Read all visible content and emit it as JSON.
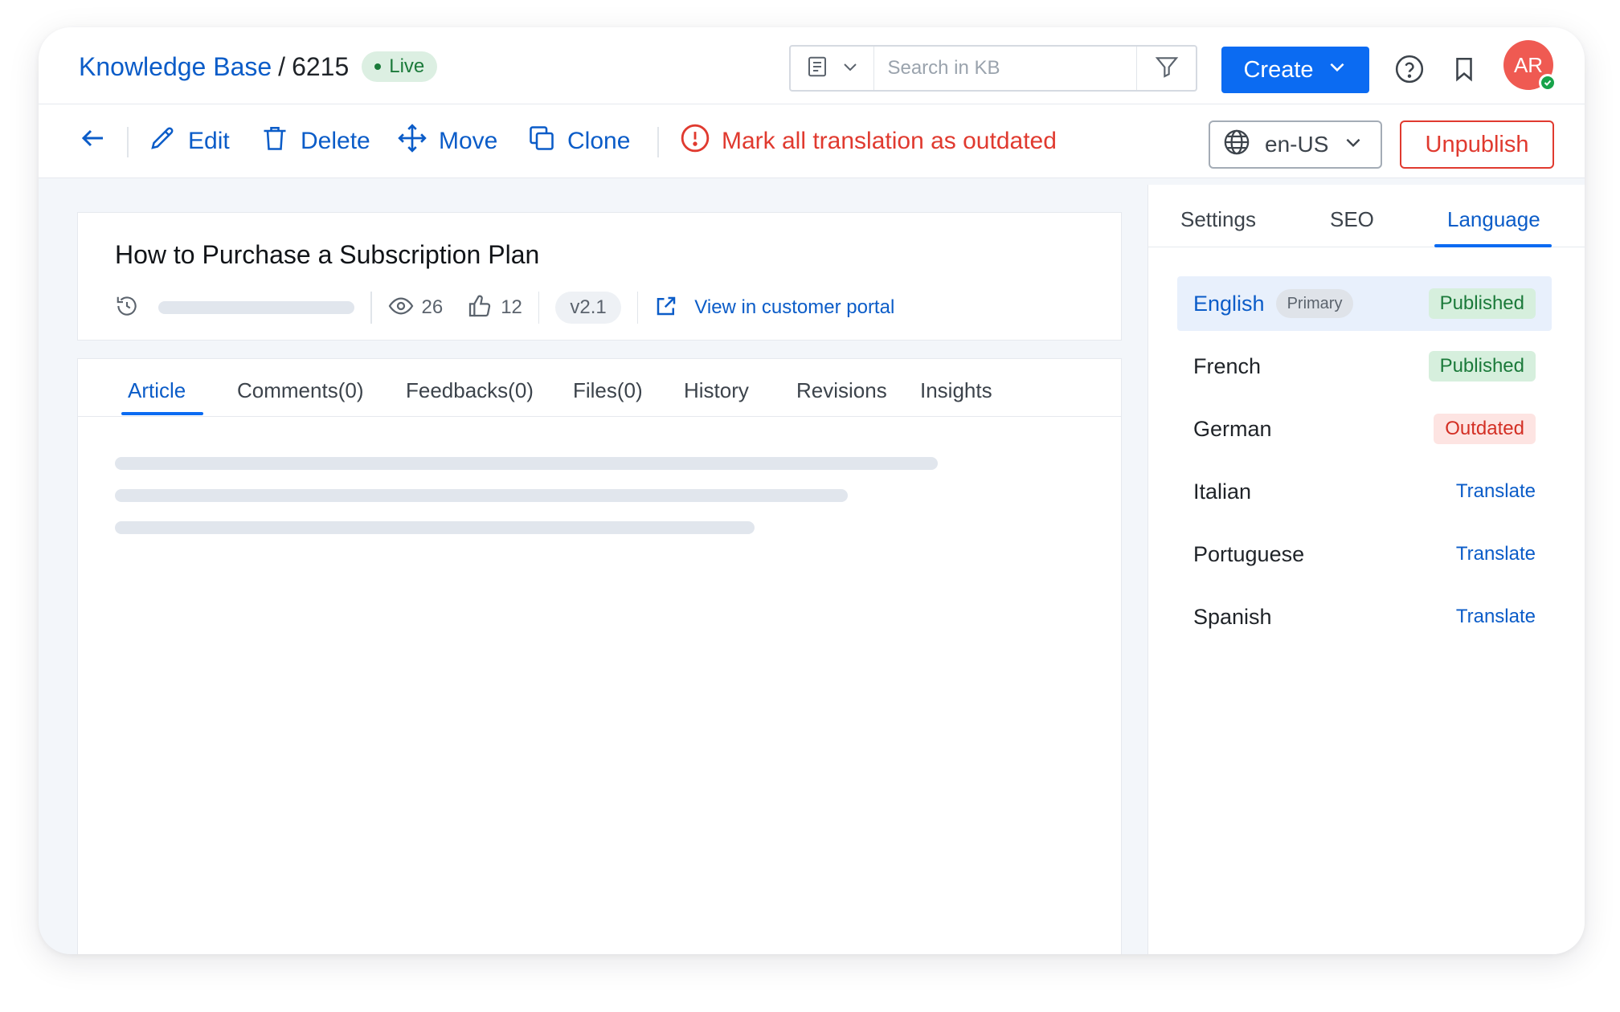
{
  "header": {
    "breadcrumb_root": "Knowledge Base",
    "breadcrumb_separator": "/",
    "breadcrumb_id": "6215",
    "live_label": "Live",
    "search_placeholder": "Search in KB",
    "create_label": "Create",
    "avatar_initials": "AR"
  },
  "toolbar": {
    "edit_label": "Edit",
    "delete_label": "Delete",
    "move_label": "Move",
    "clone_label": "Clone",
    "outdated_label": "Mark all translation as outdated",
    "locale_value": "en-US",
    "unpublish_label": "Unpublish"
  },
  "article": {
    "title": "How to Purchase a Subscription Plan",
    "views": "26",
    "likes": "12",
    "version": "v2.1",
    "portal_link": "View in customer portal",
    "tabs": [
      "Article",
      "Comments(0)",
      "Feedbacks(0)",
      "Files(0)",
      "History",
      "Revisions",
      "Insights"
    ],
    "active_tab": "Article"
  },
  "sidebar": {
    "tabs": [
      "Settings",
      "SEO",
      "Language"
    ],
    "active_tab": "Language",
    "primary_label": "Primary",
    "languages": [
      {
        "name": "English",
        "status": "Published",
        "kind": "published"
      },
      {
        "name": "French",
        "status": "Published",
        "kind": "published"
      },
      {
        "name": "German",
        "status": "Outdated",
        "kind": "outdated"
      },
      {
        "name": "Italian",
        "status": "Translate",
        "kind": "translate"
      },
      {
        "name": "Portuguese",
        "status": "Translate",
        "kind": "translate"
      },
      {
        "name": "Spanish",
        "status": "Translate",
        "kind": "translate"
      }
    ]
  },
  "colors": {
    "brand_blue": "#0b6bf2",
    "link_blue": "#0b5cc8",
    "danger_red": "#e03a2f",
    "success_green": "#1b7a3a"
  }
}
